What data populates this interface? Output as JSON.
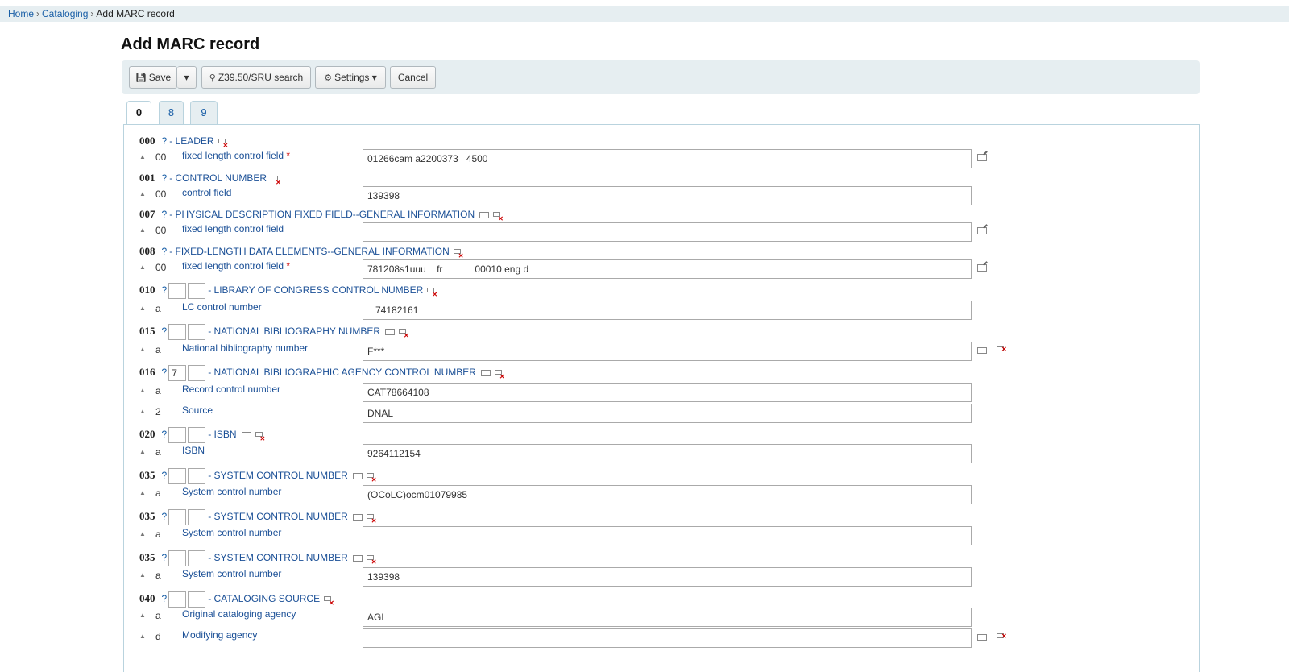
{
  "breadcrumb": {
    "home": "Home",
    "cataloging": "Cataloging",
    "current": "Add MARC record",
    "sep": "›"
  },
  "page_title": "Add MARC record",
  "toolbar": {
    "save": "Save",
    "search": "Z39.50/SRU search",
    "settings": "Settings",
    "cancel": "Cancel",
    "caret": "▾"
  },
  "tabs": [
    "0",
    "8",
    "9"
  ],
  "fields": [
    {
      "tag": "000",
      "label": "- LEADER",
      "indicators": false,
      "ind1": "",
      "ind2": "",
      "subfields": [
        {
          "code": "00",
          "label": "fixed length control field",
          "required": true,
          "value": "01266cam a2200373   4500"
        }
      ]
    },
    {
      "tag": "001",
      "label": "- CONTROL NUMBER",
      "indicators": false,
      "ind1": "",
      "ind2": "",
      "subfields": [
        {
          "code": "00",
          "label": "control field",
          "required": false,
          "value": "139398"
        }
      ]
    },
    {
      "tag": "007",
      "label": "- PHYSICAL DESCRIPTION FIXED FIELD--GENERAL INFORMATION",
      "indicators": false,
      "ind1": "",
      "ind2": "",
      "subfields": [
        {
          "code": "00",
          "label": "fixed length control field",
          "required": false,
          "value": ""
        }
      ]
    },
    {
      "tag": "008",
      "label": "- FIXED-LENGTH DATA ELEMENTS--GENERAL INFORMATION",
      "indicators": false,
      "ind1": "",
      "ind2": "",
      "subfields": [
        {
          "code": "00",
          "label": "fixed length control field",
          "required": true,
          "value": "781208s1uuu    fr            00010 eng d"
        }
      ]
    },
    {
      "tag": "010",
      "label": "- LIBRARY OF CONGRESS CONTROL NUMBER",
      "indicators": true,
      "ind1": "",
      "ind2": "",
      "subfields": [
        {
          "code": "a",
          "label": "LC control number",
          "required": false,
          "value": "   74182161"
        }
      ]
    },
    {
      "tag": "015",
      "label": "- NATIONAL BIBLIOGRAPHY NUMBER",
      "indicators": true,
      "ind1": "",
      "ind2": "",
      "subfields": [
        {
          "code": "a",
          "label": "National bibliography number",
          "required": false,
          "value": "F***"
        }
      ]
    },
    {
      "tag": "016",
      "label": "- NATIONAL BIBLIOGRAPHIC AGENCY CONTROL NUMBER",
      "indicators": true,
      "ind1": "7",
      "ind2": "",
      "subfields": [
        {
          "code": "a",
          "label": "Record control number",
          "required": false,
          "value": "CAT78664108"
        },
        {
          "code": "2",
          "label": "Source",
          "required": false,
          "value": "DNAL"
        }
      ]
    },
    {
      "tag": "020",
      "label": "- ISBN",
      "indicators": true,
      "ind1": "",
      "ind2": "",
      "subfields": [
        {
          "code": "a",
          "label": "ISBN",
          "required": false,
          "value": "9264112154"
        }
      ]
    },
    {
      "tag": "035",
      "label": "- SYSTEM CONTROL NUMBER",
      "indicators": true,
      "ind1": "",
      "ind2": "",
      "subfields": [
        {
          "code": "a",
          "label": "System control number",
          "required": false,
          "value": "(OCoLC)ocm01079985"
        }
      ]
    },
    {
      "tag": "035",
      "label": "- SYSTEM CONTROL NUMBER",
      "indicators": true,
      "ind1": "",
      "ind2": "",
      "subfields": [
        {
          "code": "a",
          "label": "System control number",
          "required": false,
          "value": ""
        }
      ]
    },
    {
      "tag": "035",
      "label": "- SYSTEM CONTROL NUMBER",
      "indicators": true,
      "ind1": "",
      "ind2": "",
      "subfields": [
        {
          "code": "a",
          "label": "System control number",
          "required": false,
          "value": "139398"
        }
      ]
    },
    {
      "tag": "040",
      "label": "- CATALOGING SOURCE",
      "indicators": true,
      "ind1": "",
      "ind2": "",
      "subfields": [
        {
          "code": "a",
          "label": "Original cataloging agency",
          "required": false,
          "value": "AGL"
        },
        {
          "code": "d",
          "label": "Modifying agency",
          "required": false,
          "value": ""
        }
      ]
    }
  ]
}
